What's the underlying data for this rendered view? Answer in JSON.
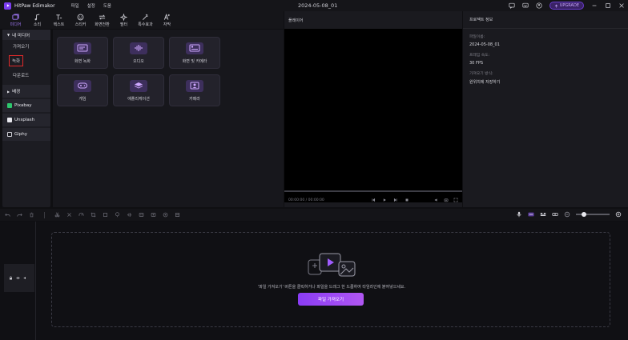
{
  "app": {
    "name": "HitPaw Edimakor",
    "project_title": "2024-05-08_01",
    "upgrade_label": "UPGRADE"
  },
  "menu": [
    "파일",
    "설정",
    "도움"
  ],
  "toolbar": [
    {
      "label": "미디어",
      "icon": "media-icon",
      "active": true
    },
    {
      "label": "소리",
      "icon": "music-icon"
    },
    {
      "label": "텍스트",
      "icon": "text-icon"
    },
    {
      "label": "스티커",
      "icon": "sticker-icon"
    },
    {
      "label": "화면전환",
      "icon": "transition-icon"
    },
    {
      "label": "필터",
      "icon": "filter-icon"
    },
    {
      "label": "특수효과",
      "icon": "effects-icon"
    },
    {
      "label": "자막",
      "icon": "subtitle-icon"
    }
  ],
  "sidebar": {
    "my_media": "내 미디어",
    "items": [
      "가져오기",
      "녹화",
      "다운로드"
    ],
    "sections": [
      "배경",
      "Pixabay",
      "Unsplash",
      "Giphy"
    ]
  },
  "media_cards": [
    "화면 녹화",
    "오디오",
    "화면 및 카메라",
    "게임",
    "애플리케이션",
    "카메라"
  ],
  "player": {
    "title": "플레이어",
    "time": "00:00:00 / 00:00:00"
  },
  "info": {
    "title": "프로젝트 정보",
    "fields": [
      {
        "label": "파일이름:",
        "value": "2024-05-08_01"
      },
      {
        "label": "프레임 속도:",
        "value": "30 FPS"
      },
      {
        "label": "가져오기 방식:",
        "value": "원위치에 저장하기"
      }
    ]
  },
  "timeline": {
    "drop_text": "'파일 가져오기' 버튼을 클릭하거나 파일을 드래그 한 드롭하여 타임라인에 붙여넣으세요.",
    "import_button": "파일 가져오기"
  },
  "colors": {
    "accent": "#8a3cf5",
    "highlight_box": "#e02a2a"
  }
}
